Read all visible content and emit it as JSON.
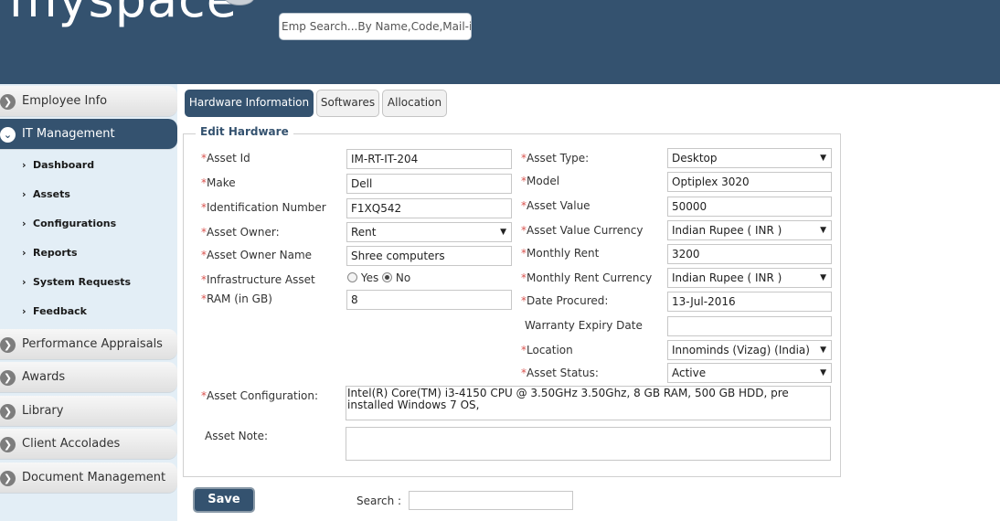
{
  "header": {
    "logo_text": "myspace",
    "search_placeholder": "Emp Search...By Name,Code,Mail-id"
  },
  "sidebar": {
    "items": [
      {
        "label": "Employee Info"
      },
      {
        "label": "IT Management"
      },
      {
        "label": "Performance Appraisals"
      },
      {
        "label": "Awards"
      },
      {
        "label": "Library"
      },
      {
        "label": "Client Accolades"
      },
      {
        "label": "Document Management"
      }
    ],
    "sub_items": [
      {
        "label": "Dashboard"
      },
      {
        "label": "Assets"
      },
      {
        "label": "Configurations"
      },
      {
        "label": "Reports"
      },
      {
        "label": "System Requests"
      },
      {
        "label": "Feedback"
      }
    ]
  },
  "tabs": [
    {
      "label": "Hardware Information"
    },
    {
      "label": "Softwares"
    },
    {
      "label": "Allocation"
    }
  ],
  "form": {
    "legend": "Edit Hardware",
    "asset_id": {
      "label": "Asset Id",
      "value": "IM-RT-IT-204"
    },
    "make": {
      "label": "Make",
      "value": "Dell"
    },
    "identification_number": {
      "label": "Identification Number",
      "value": "F1XQ542"
    },
    "asset_owner": {
      "label": "Asset Owner:",
      "value": "Rent"
    },
    "asset_owner_name": {
      "label": "Asset Owner Name",
      "value": "Shree computers"
    },
    "infrastructure_asset": {
      "label": "Infrastructure Asset",
      "yes": "Yes",
      "no": "No",
      "selected": "No"
    },
    "ram": {
      "label": "RAM (in GB)",
      "value": "8"
    },
    "asset_type": {
      "label": "Asset Type:",
      "value": "Desktop"
    },
    "model": {
      "label": "Model",
      "value": "Optiplex 3020"
    },
    "asset_value": {
      "label": "Asset Value",
      "value": "50000"
    },
    "asset_value_currency": {
      "label": "Asset Value Currency",
      "value": "Indian Rupee ( INR )"
    },
    "monthly_rent": {
      "label": "Monthly Rent",
      "value": "3200"
    },
    "monthly_rent_currency": {
      "label": "Monthly Rent Currency",
      "value": "Indian Rupee ( INR )"
    },
    "date_procured": {
      "label": "Date Procured:",
      "value": "13-Jul-2016"
    },
    "warranty_expiry_date": {
      "label": "Warranty Expiry Date",
      "value": ""
    },
    "location": {
      "label": "Location",
      "value": "Innominds (Vizag) (India)"
    },
    "asset_status": {
      "label": "Asset Status:",
      "value": "Active"
    },
    "asset_configuration": {
      "label": "Asset Configuration:",
      "value": "Intel(R) Core(TM) i3-4150 CPU @ 3.50GHz 3.50Ghz, 8 GB RAM, 500 GB HDD, pre installed Windows 7 OS,"
    },
    "asset_note": {
      "label": "Asset Note:",
      "value": ""
    },
    "required_marker": "*"
  },
  "footer": {
    "save_label": "Save",
    "search_label": "Search :"
  }
}
